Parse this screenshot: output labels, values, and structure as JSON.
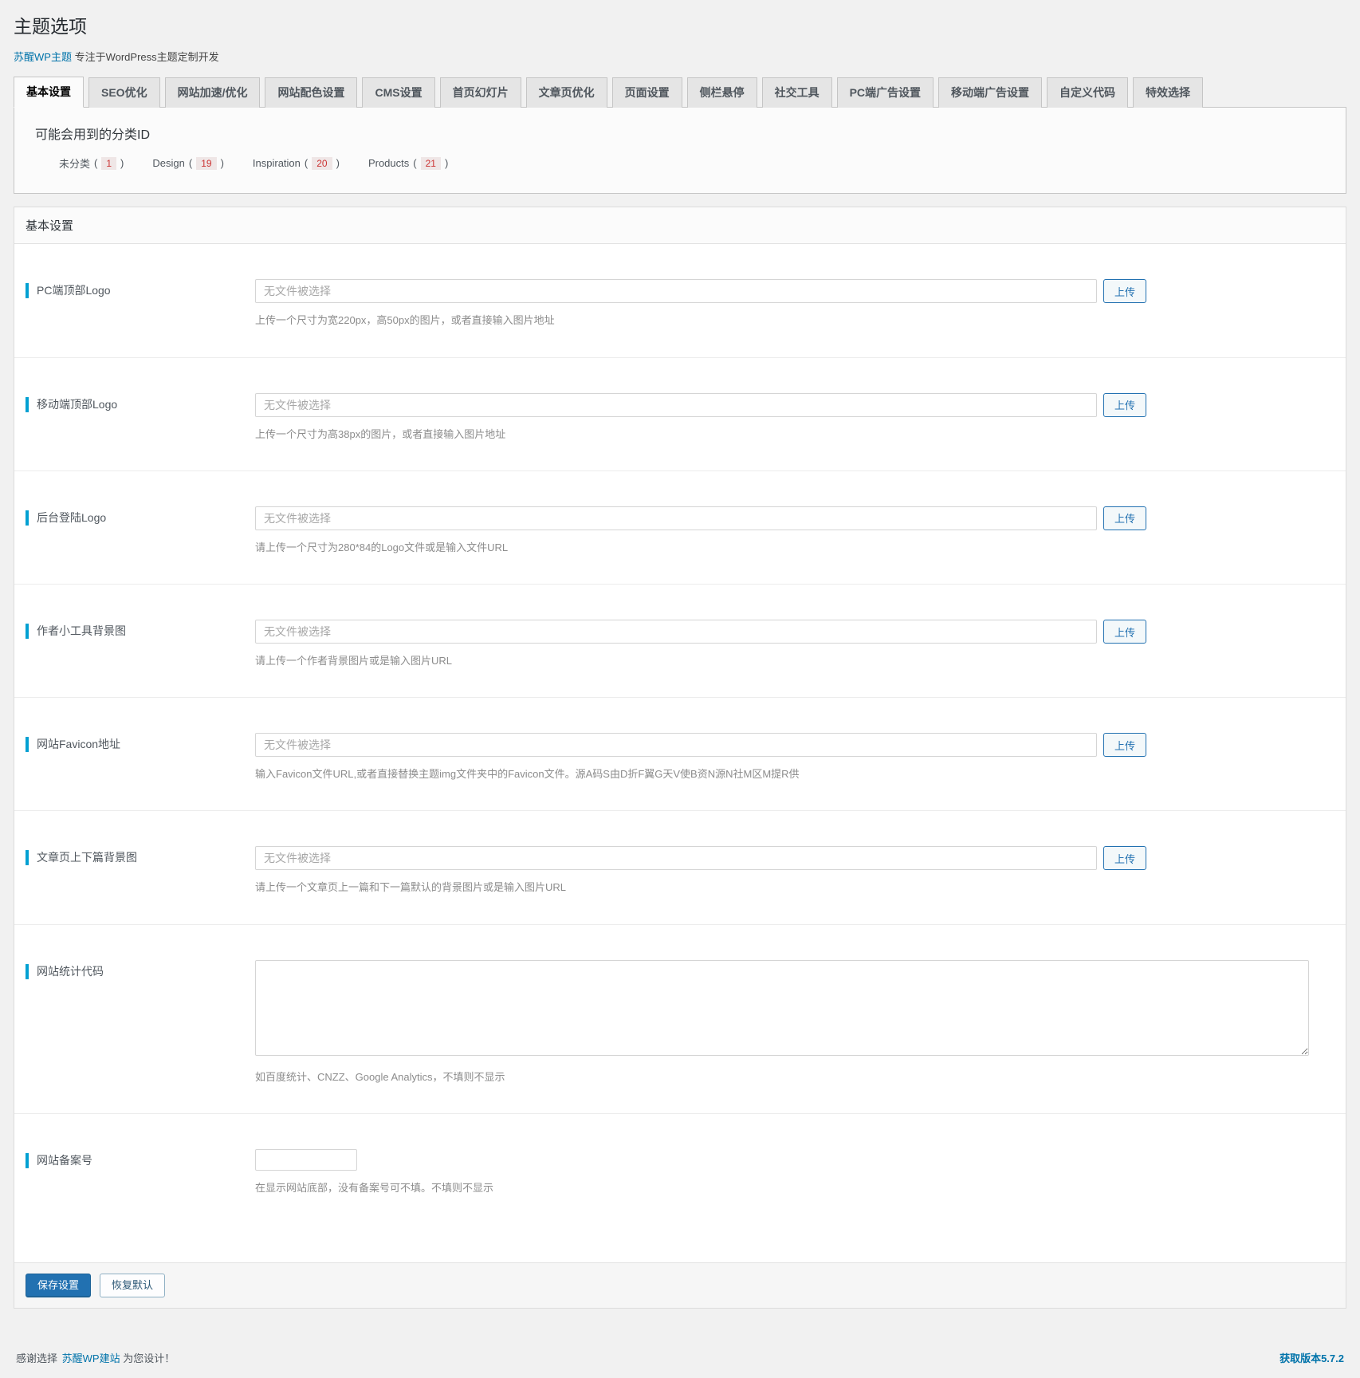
{
  "page_title": "主题选项",
  "subtitle": {
    "link_text": "苏醒WP主题",
    "text": "专注于WordPress主题定制开发"
  },
  "tabs": [
    {
      "label": "基本设置",
      "active": true
    },
    {
      "label": "SEO优化",
      "active": false
    },
    {
      "label": "网站加速/优化",
      "active": false
    },
    {
      "label": "网站配色设置",
      "active": false
    },
    {
      "label": "CMS设置",
      "active": false
    },
    {
      "label": "首页幻灯片",
      "active": false
    },
    {
      "label": "文章页优化",
      "active": false
    },
    {
      "label": "页面设置",
      "active": false
    },
    {
      "label": "侧栏悬停",
      "active": false
    },
    {
      "label": "社交工具",
      "active": false
    },
    {
      "label": "PC端广告设置",
      "active": false
    },
    {
      "label": "移动端广告设置",
      "active": false
    },
    {
      "label": "自定义代码",
      "active": false
    },
    {
      "label": "特效选择",
      "active": false
    }
  ],
  "category_box": {
    "title": "可能会用到的分类ID",
    "paren_open": "(",
    "paren_close": ")",
    "items": [
      {
        "name": "未分类",
        "id": "1"
      },
      {
        "name": "Design",
        "id": "19"
      },
      {
        "name": "Inspiration",
        "id": "20"
      },
      {
        "name": "Products",
        "id": "21"
      }
    ]
  },
  "panel": {
    "title": "基本设置",
    "upload_label": "上传",
    "file_placeholder": "无文件被选择",
    "rows": [
      {
        "label": "PC端顶部Logo",
        "hint": "上传一个尺寸为宽220px，高50px的图片，或者直接输入图片地址"
      },
      {
        "label": "移动端顶部Logo",
        "hint": "上传一个尺寸为高38px的图片，或者直接输入图片地址"
      },
      {
        "label": "后台登陆Logo",
        "hint": "请上传一个尺寸为280*84的Logo文件或是输入文件URL"
      },
      {
        "label": "作者小工具背景图",
        "hint": "请上传一个作者背景图片或是输入图片URL"
      },
      {
        "label": "网站Favicon地址",
        "hint": "输入Favicon文件URL,或者直接替换主题img文件夹中的Favicon文件。源A码S由D折F翼G天V使B资N源N社M区M提R供"
      },
      {
        "label": "文章页上下篇背景图",
        "hint": "请上传一个文章页上一篇和下一篇默认的背景图片或是输入图片URL"
      },
      {
        "label": "网站统计代码",
        "hint": "如百度统计、CNZZ、Google Analytics，不填则不显示"
      },
      {
        "label": "网站备案号",
        "hint": "在显示网站底部，没有备案号可不填。不填则不显示"
      }
    ]
  },
  "actions": {
    "save": "保存设置",
    "reset": "恢复默认"
  },
  "footer": {
    "prefix": "感谢选择",
    "link_text": "苏醒WP建站",
    "suffix": "为您设计！",
    "version_link": "获取版本5.7.2"
  },
  "colors": {
    "accent_bar": "#00a0d2",
    "link_blue": "#0073aa",
    "button_blue": "#2271b1",
    "count_red": "#cc3333",
    "page_bg": "#f1f1f1"
  }
}
